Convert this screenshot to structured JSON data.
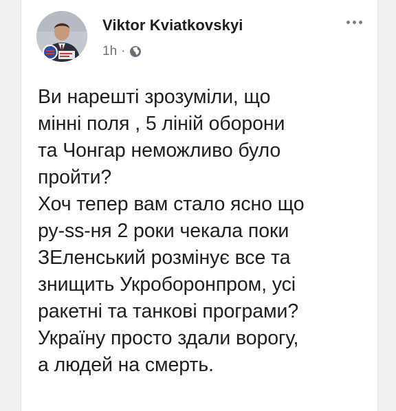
{
  "post": {
    "author": "Viktor Kviatkovskyi",
    "time": "1h",
    "separator": "·",
    "privacy_icon": "globe-icon",
    "menu_icon": "more-options-icon",
    "text": "Ви нарешті зрозуміли, що\nмінні поля , 5 ліній оборони\nта Чонгар неможливо було\nпройти?\nХоч тепер вам стало ясно що\nру-ss-ня 2 роки чекала поки\nЗЕленський розмінує все та\nзнищить Укроборонпром, усі\nракетні та танкові програми?\nУкраїну просто здали ворогу,\nа людей на смерть."
  }
}
